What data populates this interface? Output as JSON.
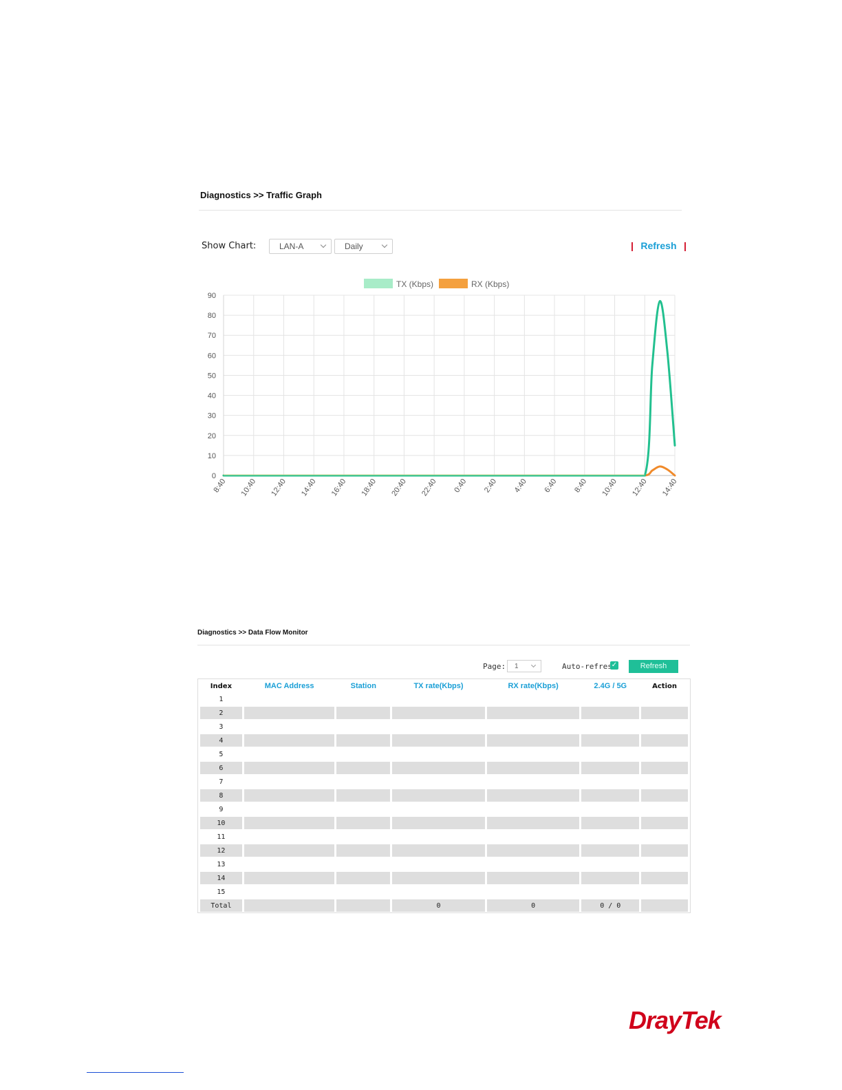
{
  "traffic_graph": {
    "title": "Diagnostics >> Traffic Graph",
    "show_chart_label": "Show Chart:",
    "interface_select": "LAN-A",
    "period_select": "Daily",
    "refresh_label": "Refresh",
    "pipe": "|",
    "colors": {
      "tx": "#22c08f",
      "rx": "#f08a2a",
      "tx_legend": "#a8ecc8",
      "rx_legend": "#f4a03e",
      "accent": "#1a9fd6"
    }
  },
  "chart_data": {
    "type": "line",
    "title": "",
    "xlabel": "",
    "ylabel": "",
    "ylim": [
      0,
      90
    ],
    "yticks": [
      0,
      10,
      20,
      30,
      40,
      50,
      60,
      70,
      80,
      90
    ],
    "x_tick_labels": [
      "8:40",
      "10:40",
      "12:40",
      "14:40",
      "16:40",
      "18:40",
      "20:40",
      "22:40",
      "0:40",
      "2:40",
      "4:40",
      "6:40",
      "8:40",
      "10:40",
      "12:40",
      "14:40"
    ],
    "grid": true,
    "legend_position": "top-center",
    "x": [
      0,
      1,
      2,
      3,
      4,
      5,
      6,
      7,
      8,
      9,
      10,
      11,
      12,
      13,
      14,
      14.25,
      14.5,
      14.75,
      15
    ],
    "series": [
      {
        "name": "TX (Kbps)",
        "values": [
          0,
          0,
          0,
          0,
          0,
          0,
          0,
          0,
          0,
          0,
          0,
          0,
          0,
          0,
          0,
          55,
          87,
          62,
          15
        ]
      },
      {
        "name": "RX (Kbps)",
        "values": [
          0,
          0,
          0,
          0,
          0,
          0,
          0,
          0,
          0,
          0,
          0,
          0,
          0,
          0,
          0,
          2.5,
          4.5,
          3,
          0
        ]
      }
    ]
  },
  "data_flow": {
    "title": "Diagnostics >> Data Flow Monitor",
    "page_label": "Page:",
    "page_value": "1",
    "auto_refresh_label": "Auto-refresh",
    "auto_refresh_checked": "✓",
    "refresh_button": "Refresh",
    "columns": [
      "Index",
      "MAC Address",
      "Station",
      "TX rate(Kbps)",
      "RX rate(Kbps)",
      "2.4G / 5G",
      "Action"
    ],
    "rows": [
      "1",
      "2",
      "3",
      "4",
      "5",
      "6",
      "7",
      "8",
      "9",
      "10",
      "11",
      "12",
      "13",
      "14",
      "15"
    ],
    "total": {
      "label": "Total",
      "tx": "0",
      "rx": "0",
      "band": "0 / 0"
    }
  },
  "footer": {
    "logo": "DrayTek"
  }
}
